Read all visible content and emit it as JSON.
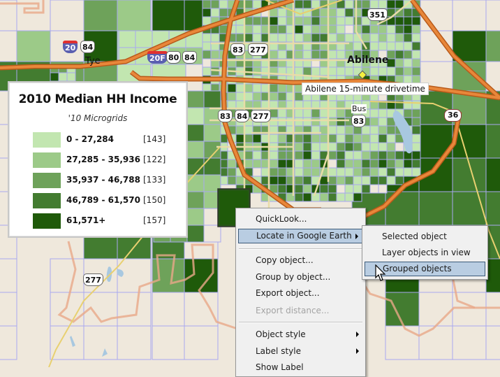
{
  "map": {
    "place_labels": [
      {
        "name": "Tye"
      },
      {
        "name": "Abilene"
      },
      {
        "name": "Bus"
      }
    ],
    "callout": "Abilene 15-minute drivetime",
    "route_shields": {
      "i20": "20",
      "us84_west": "84",
      "i20f": "20F",
      "us80": "80",
      "us84_mid": "84",
      "us83_north": "83",
      "us277_north": "277",
      "us351": "351",
      "us83_south": "83",
      "us84_south": "84",
      "us277_south": "277",
      "bus83": "83",
      "sh36": "36",
      "us277_far_south": "277"
    },
    "colors": {
      "background": "#efe8dc",
      "grid_line": "#a8a8f0",
      "highway": "#e07a2a",
      "highway_edge": "#b85a1a",
      "local_road": "#e8dca8",
      "water": "#a8c8e0",
      "boundary": "#e8a888"
    }
  },
  "legend": {
    "title": "2010 Median HH Income",
    "subtitle": "'10 Microgrids",
    "classes": [
      {
        "range": "0 - 27,284",
        "count": "[143]",
        "color": "#c2e6b0"
      },
      {
        "range": "27,285 - 35,936",
        "count": "[122]",
        "color": "#9cca88"
      },
      {
        "range": "35,937 - 46,788",
        "count": "[133]",
        "color": "#6ea25a"
      },
      {
        "range": "46,789 - 61,570",
        "count": "[150]",
        "color": "#437c30"
      },
      {
        "range": "61,571+",
        "count": "[157]",
        "color": "#1f5a0a"
      }
    ]
  },
  "context_menu": {
    "items": [
      {
        "label": "QuickLook...",
        "enabled": true,
        "submenu": false
      },
      {
        "label": "Locate in Google Earth",
        "enabled": true,
        "submenu": true,
        "highlighted": true
      },
      {
        "separator": true
      },
      {
        "label": "Copy object...",
        "enabled": true,
        "submenu": false
      },
      {
        "label": "Group by object...",
        "enabled": true,
        "submenu": false
      },
      {
        "label": "Export object...",
        "enabled": true,
        "submenu": false
      },
      {
        "label": "Export distance...",
        "enabled": false,
        "submenu": false
      },
      {
        "separator": true
      },
      {
        "label": "Object style",
        "enabled": true,
        "submenu": true
      },
      {
        "label": "Label style",
        "enabled": true,
        "submenu": true
      },
      {
        "label": "Show Label",
        "enabled": true,
        "submenu": false
      }
    ]
  },
  "submenu": {
    "items": [
      {
        "label": "Selected object"
      },
      {
        "label": "Layer objects in view"
      },
      {
        "label": "Grouped objects",
        "highlighted": true
      }
    ]
  }
}
